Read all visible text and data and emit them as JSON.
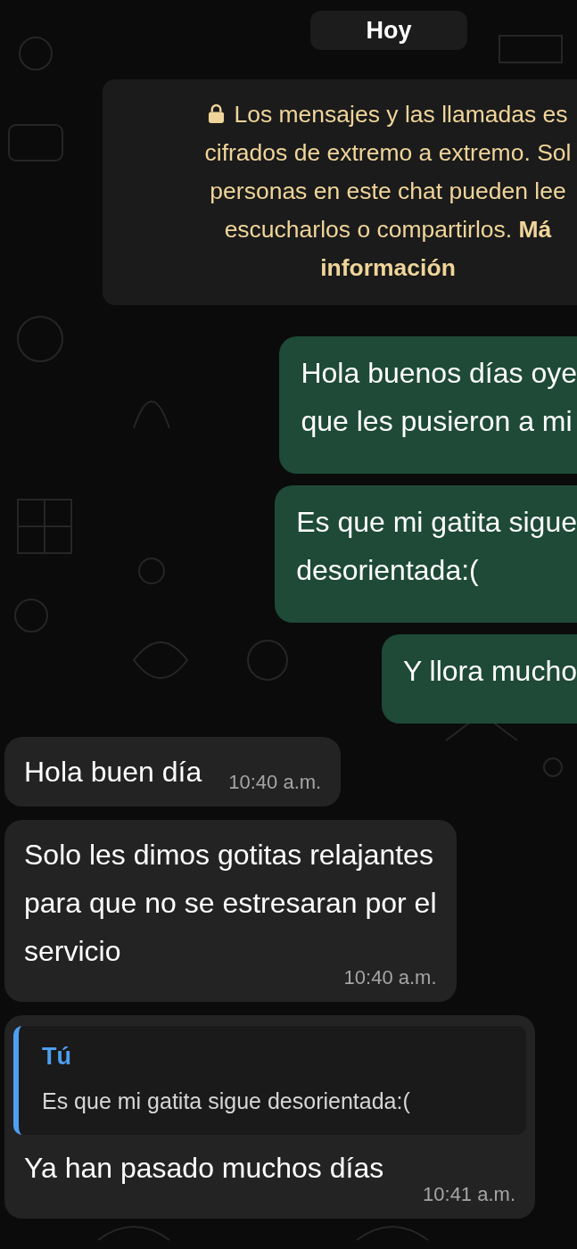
{
  "date_label": "Hoy",
  "notice": {
    "lines": [
      "Los mensajes y las llamadas es",
      "cifrados de extremo a extremo. Sol",
      "personas en este chat pueden lee",
      "escucharlos o compartirlos. **Má**",
      "**información**"
    ]
  },
  "messages": [
    {
      "kind": "outgoing",
      "lines": [
        "Hola buenos días oye",
        "que les pusieron a mi"
      ]
    },
    {
      "kind": "outgoing",
      "lines": [
        "Es que mi gatita sigue",
        "desorientada:("
      ]
    },
    {
      "kind": "outgoing",
      "lines": [
        "Y llora mucho"
      ]
    },
    {
      "kind": "incoming",
      "lines": [
        "Hola buen día"
      ],
      "time": "10:40 a.m."
    },
    {
      "kind": "incoming",
      "lines": [
        "Solo les dimos gotitas relajantes",
        "para que no se estresaran por el",
        "servicio"
      ],
      "time": "10:40 a.m."
    },
    {
      "kind": "reply",
      "quote_author": "Tú",
      "quote_text": "Es que mi gatita sigue desorientada:(",
      "lines": [
        "Ya han pasado muchos días"
      ],
      "time": "10:41 a.m."
    }
  ]
}
